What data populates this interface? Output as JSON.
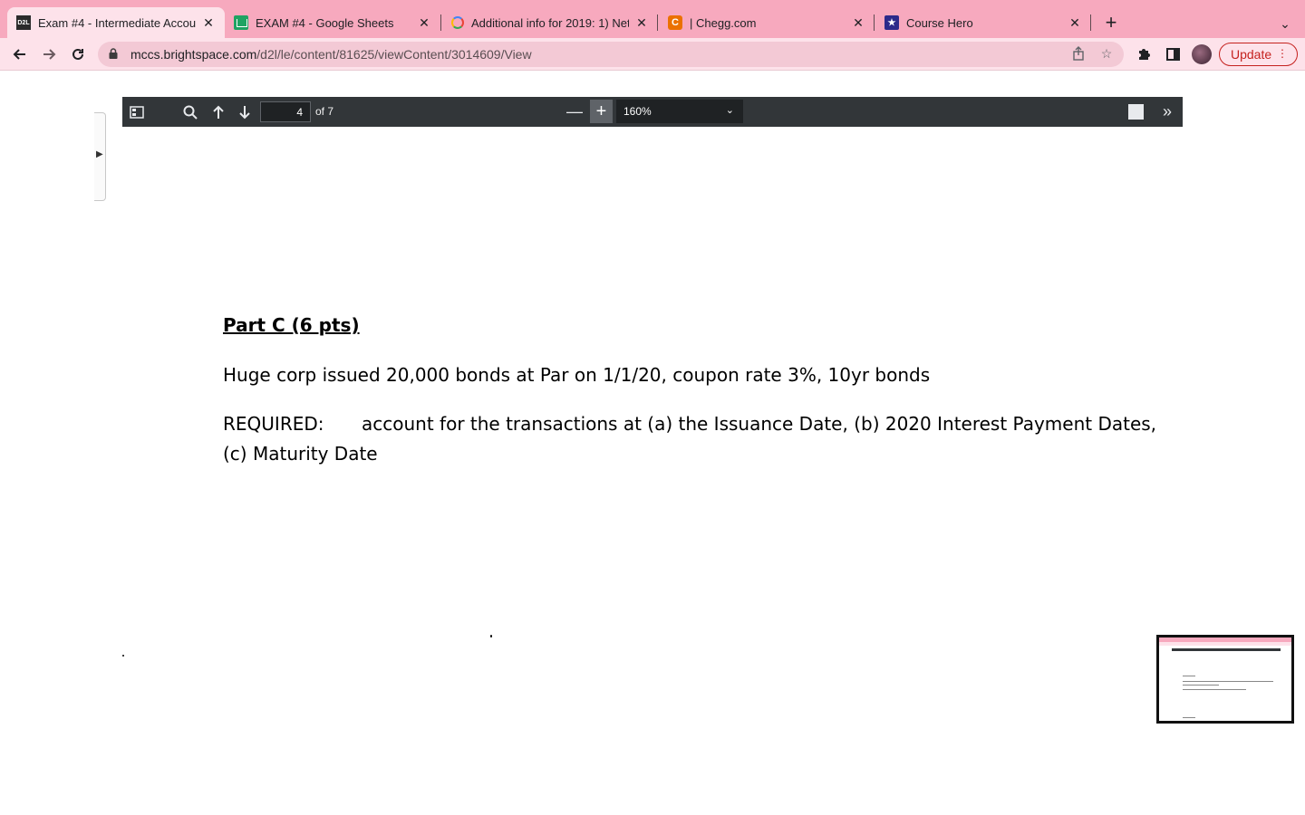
{
  "tabs": [
    {
      "title": "Exam #4 - Intermediate Accour",
      "favicon": "d2l-icon",
      "favicon_text": "D2L",
      "active": true
    },
    {
      "title": "EXAM #4 - Google Sheets",
      "favicon": "sheets-icon",
      "active": false
    },
    {
      "title": "Additional info for 2019: 1) Net",
      "favicon": "google-icon",
      "favicon_text": "G",
      "active": false
    },
    {
      "title": "| Chegg.com",
      "favicon": "chegg-icon",
      "favicon_text": "C",
      "active": false
    },
    {
      "title": "Course Hero",
      "favicon": "coursehero-icon",
      "favicon_text": "★",
      "active": false
    }
  ],
  "toolbar": {
    "url_domain": "mccs.brightspace.com",
    "url_path": "/d2l/le/content/81625/viewContent/3014609/View",
    "update_label": "Update"
  },
  "pdf": {
    "page_current": "4",
    "page_of": "of 7",
    "zoom": "160%"
  },
  "document": {
    "heading": "Part C (6 pts)",
    "line1": "Huge corp issued 20,000 bonds at Par on 1/1/20, coupon rate 3%, 10yr bonds",
    "required_label": "REQUIRED:",
    "required_text": "account for the transactions at (a) the Issuance Date, (b) 2020 Interest Payment Dates,",
    "required_text_cont": "(c) Maturity Date"
  },
  "colors": {
    "tabstrip": "#f7a9be",
    "toolbar": "#fde2ea",
    "pdf_bar": "#323639",
    "update_accent": "#c5221f"
  }
}
